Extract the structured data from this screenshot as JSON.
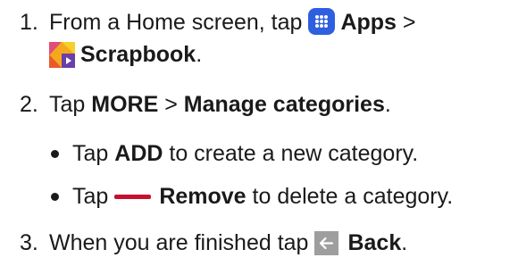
{
  "steps": [
    {
      "number": "1.",
      "line1": {
        "before": "From a Home screen, tap",
        "bold": "Apps",
        "after": " >"
      },
      "line2": {
        "bold": "Scrapbook",
        "after": "."
      },
      "icons": [
        "apps-icon",
        "scrapbook-icon"
      ]
    },
    {
      "number": "2.",
      "before": "Tap ",
      "bold1": "MORE",
      "middle": " > ",
      "bold2": "Manage categories",
      "after": "."
    },
    {
      "number": "3.",
      "before": "When you are finished tap",
      "bold": "Back",
      "after": ".",
      "icon": "back-arrow-icon"
    }
  ],
  "bullets": [
    {
      "before": "Tap ",
      "bold": "ADD",
      "after": " to create a new category."
    },
    {
      "before": "Tap",
      "bold": "Remove",
      "after": " to delete a category.",
      "icon": "remove-icon"
    }
  ],
  "colors": {
    "apps_icon": "#2e5fe0",
    "remove_icon": "#c8102e",
    "back_icon": "#9e9e9e",
    "text": "#1a1a1a"
  }
}
